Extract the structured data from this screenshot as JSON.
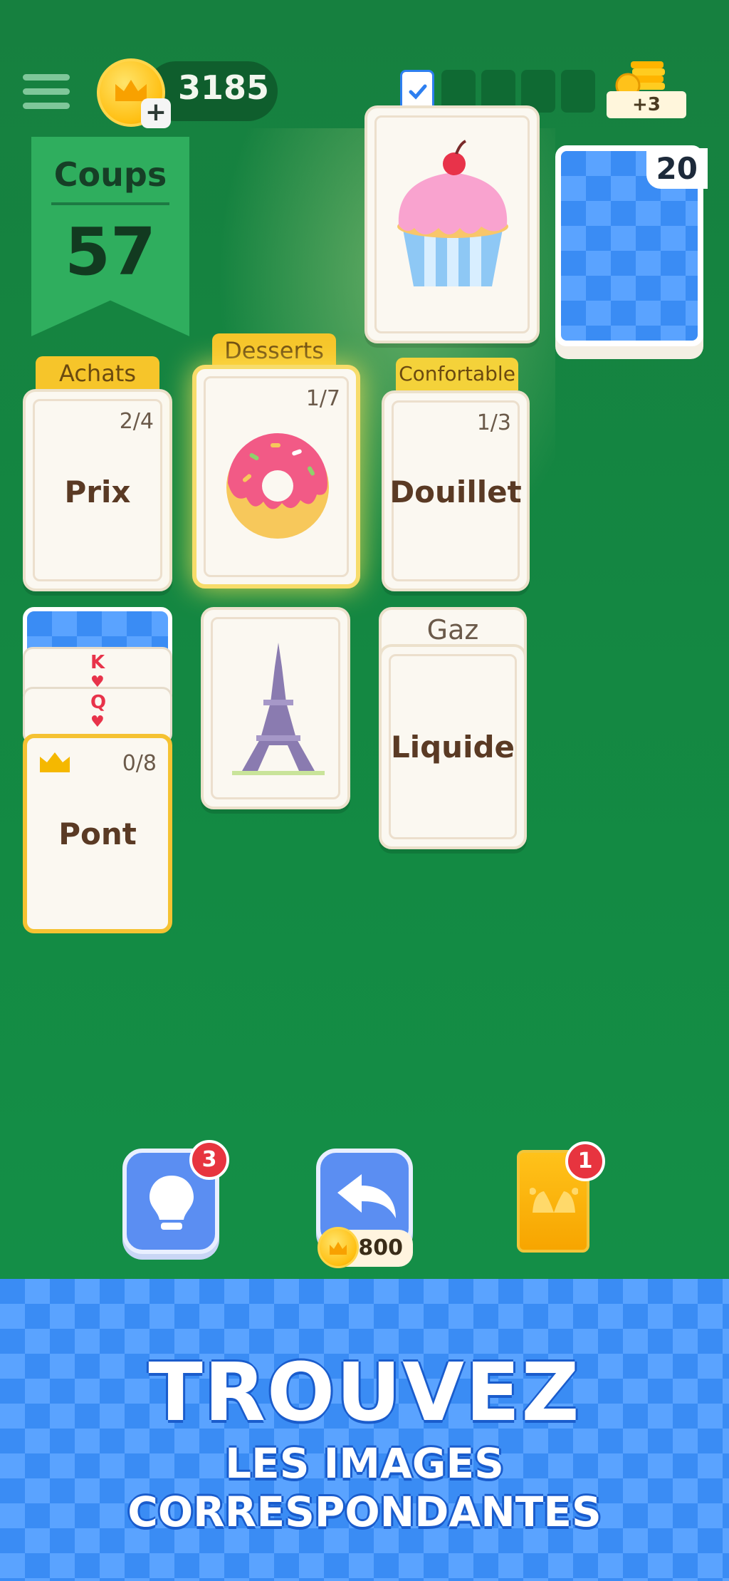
{
  "header": {
    "coins": "3185",
    "plus": "+",
    "progress_boxes": [
      true,
      false,
      false,
      false,
      false
    ],
    "reward_label": "+3"
  },
  "banner": {
    "label": "Coups",
    "value": "57"
  },
  "deck": {
    "count": "20"
  },
  "categories": [
    {
      "tab": "Achats",
      "count": "2/4",
      "word": "Prix"
    },
    {
      "tab": "Desserts",
      "count": "1/7",
      "word": ""
    },
    {
      "tab": "Confortable",
      "count": "1/3",
      "word": "Douillet"
    }
  ],
  "piles": {
    "left": {
      "cards": [
        "K",
        "Q"
      ],
      "top_count": "0/8",
      "top_word": "Pont"
    },
    "right": {
      "under_word": "Gaz",
      "top_word": "Liquide"
    }
  },
  "buttons": {
    "hint_badge": "3",
    "undo_cost": "800",
    "joker_badge": "1"
  },
  "promo": {
    "title": "TROUVEZ",
    "subtitle": "LES IMAGES CORRESPONDANTES"
  },
  "colors": {
    "table_green": "#138a43",
    "accent_gold": "#f6c52a",
    "card_back_blue": "#3a8cf4",
    "badge_red": "#e7343f"
  }
}
